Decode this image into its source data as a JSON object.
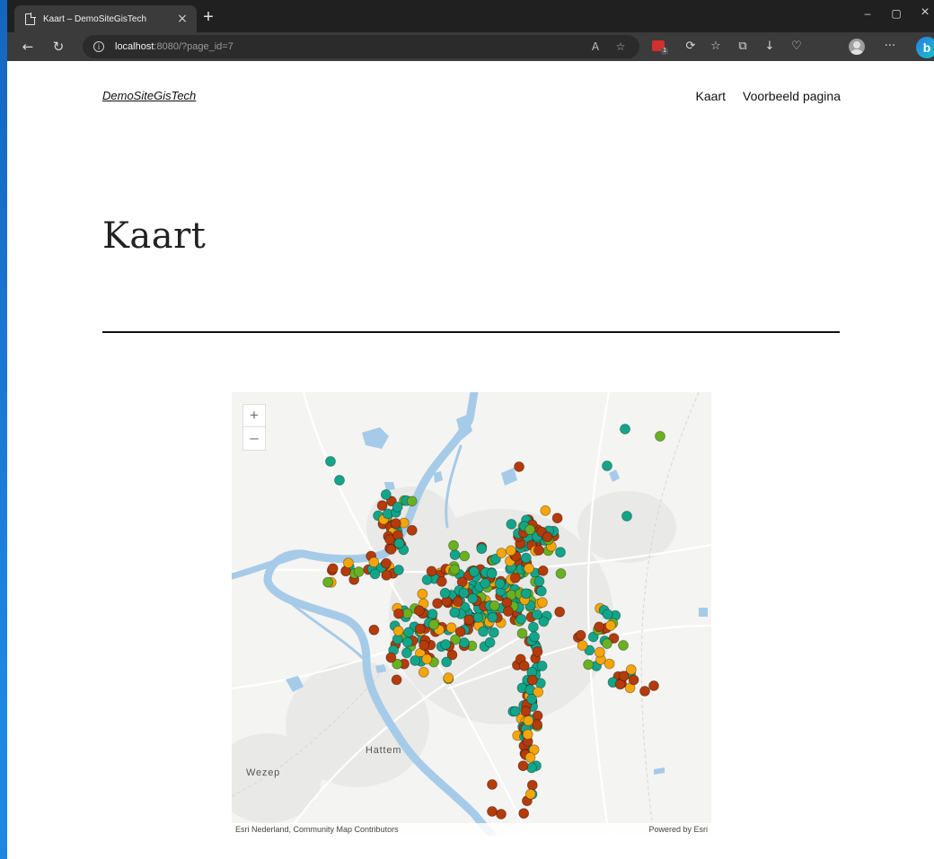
{
  "browser": {
    "tab_title": "Kaart – DemoSiteGisTech",
    "url_host": "localhost",
    "url_rest": ":8080/?page_id=7",
    "ext_badge_count": "1"
  },
  "site": {
    "title": "DemoSiteGisTech",
    "nav": [
      {
        "label": "Kaart"
      },
      {
        "label": "Voorbeeld pagina"
      }
    ]
  },
  "page": {
    "heading": "Kaart"
  },
  "map": {
    "zoom_in": "+",
    "zoom_out": "–",
    "labels": {
      "hattem": "Hattem",
      "wezep": "Wezep"
    },
    "attribution_left": "Esri Nederland, Community Map Contributors",
    "attribution_right": "Powered by Esri",
    "colors": {
      "teal": "#12a58a",
      "rust": "#b33b0c",
      "orange": "#f5a50a",
      "green": "#6ab023",
      "water": "#a6cbe8"
    }
  }
}
